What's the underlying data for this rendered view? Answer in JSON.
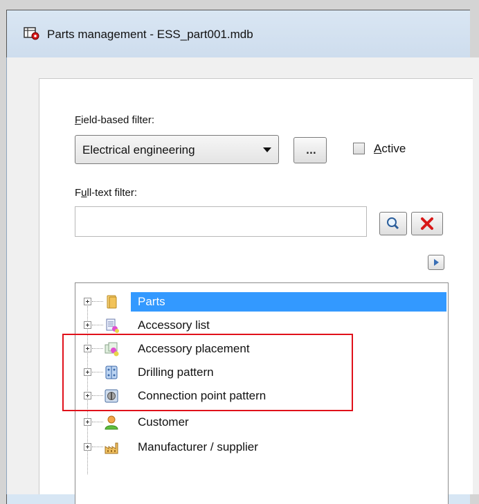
{
  "window": {
    "title": "Parts management - ESS_part001.mdb",
    "icon": "parts-management-app-icon"
  },
  "field_filter": {
    "label": "Field-based filter:",
    "selected": "Electrical engineering",
    "more_button_label": "...",
    "active_label": "Active",
    "active_checked": false
  },
  "fulltext_filter": {
    "label": "Full-text filter:",
    "value": "",
    "placeholder": ""
  },
  "tree": {
    "items": [
      {
        "label": "Parts",
        "icon": "folder-icon",
        "selected": true
      },
      {
        "label": "Accessory list",
        "icon": "accessory-list-icon",
        "selected": false
      },
      {
        "label": "Accessory placement",
        "icon": "accessory-placement-icon",
        "selected": false
      },
      {
        "label": "Drilling pattern",
        "icon": "drilling-pattern-icon",
        "selected": false
      },
      {
        "label": "Connection point pattern",
        "icon": "connection-point-pattern-icon",
        "selected": false
      },
      {
        "label": "Customer",
        "icon": "customer-icon",
        "selected": false
      },
      {
        "label": "Manufacturer / supplier",
        "icon": "manufacturer-icon",
        "selected": false
      }
    ]
  },
  "colors": {
    "selection": "#3399ff",
    "highlight_box": "#e0101a"
  }
}
